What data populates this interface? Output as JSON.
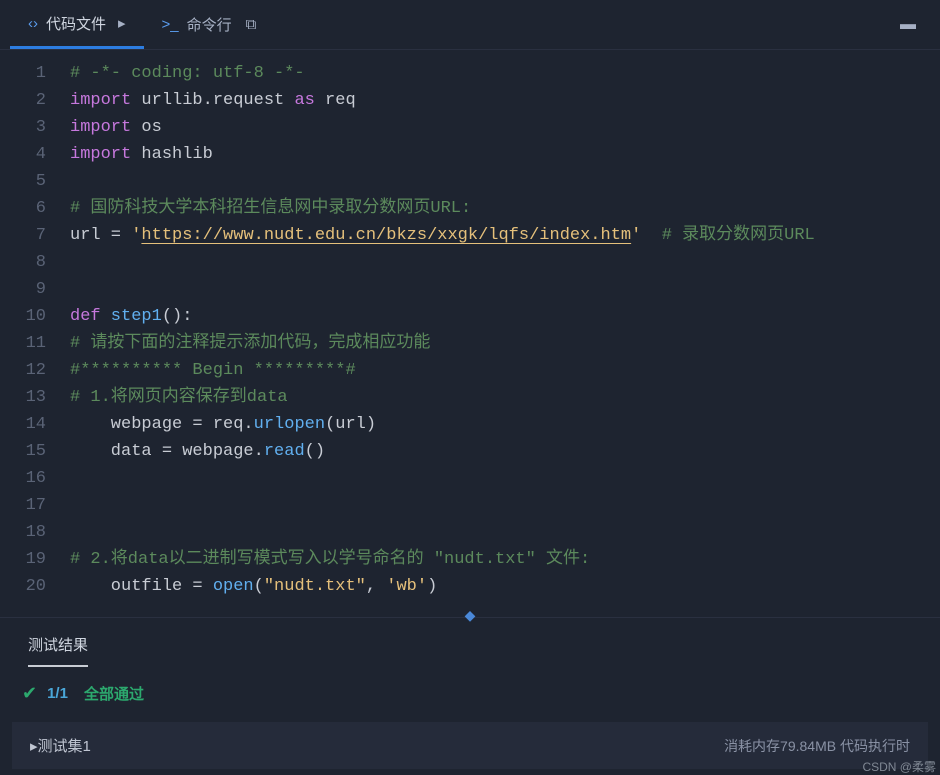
{
  "tabs": {
    "file": "代码文件",
    "terminal": "命令行"
  },
  "lines": [
    1,
    2,
    3,
    4,
    5,
    6,
    7,
    8,
    9,
    10,
    11,
    12,
    13,
    14,
    15,
    16,
    17,
    18,
    19,
    20
  ],
  "code": {
    "l1_comment": "# -*- coding: utf-8 -*-",
    "l2_import": "import",
    "l2_mod": " urllib.request ",
    "l2_as": "as",
    "l2_alias": " req",
    "l3_import": "import",
    "l3_mod": " os",
    "l4_import": "import",
    "l4_mod": " hashlib",
    "l6_comment": "# 国防科技大学本科招生信息网中录取分数网页URL:",
    "l7_var": "url = ",
    "l7_q1": "'",
    "l7_url": "https://www.nudt.edu.cn/bkzs/xxgk/lqfs/index.htm",
    "l7_q2": "'",
    "l7_cend": "  # 录取分数网页URL",
    "l10_def": "def",
    "l10_fn": " step1",
    "l10_paren": "():",
    "l11_comment": "# 请按下面的注释提示添加代码，完成相应功能",
    "l12_comment": "#********** Begin *********#",
    "l13_comment": "# 1.将网页内容保存到data",
    "l14_a": "    webpage = req.",
    "l14_fn": "urlopen",
    "l14_b": "(url)",
    "l15_a": "    data = webpage.",
    "l15_fn": "read",
    "l15_b": "()",
    "l19_comment": "# 2.将data以二进制写模式写入以学号命名的 \"nudt.txt\" 文件:",
    "l20_a": "    outfile = ",
    "l20_fn": "open",
    "l20_b": "(",
    "l20_s1": "\"nudt.txt\"",
    "l20_c": ", ",
    "l20_s2": "'wb'",
    "l20_d": ")"
  },
  "results": {
    "tab": "测试结果",
    "count": "1/1",
    "pass": "全部通过",
    "set_name": "   测试集1",
    "status": "消耗内存79.84MB    代码执行时"
  },
  "watermark": "CSDN @柔雾"
}
